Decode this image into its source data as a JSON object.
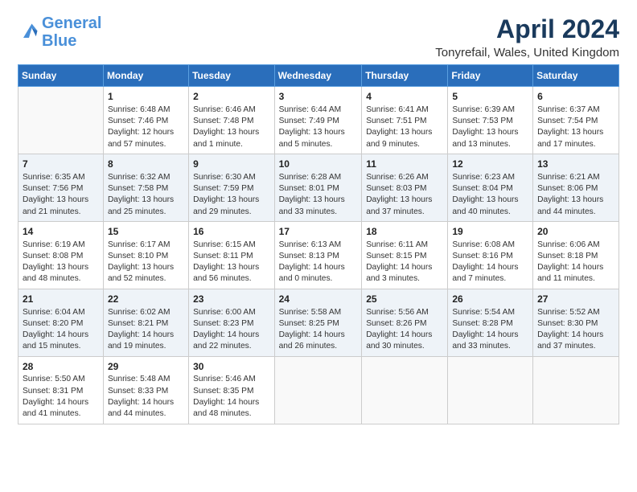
{
  "logo": {
    "text_general": "General",
    "text_blue": "Blue"
  },
  "title": "April 2024",
  "subtitle": "Tonyrefail, Wales, United Kingdom",
  "calendar": {
    "headers": [
      "Sunday",
      "Monday",
      "Tuesday",
      "Wednesday",
      "Thursday",
      "Friday",
      "Saturday"
    ],
    "weeks": [
      [
        {
          "day": "",
          "info": ""
        },
        {
          "day": "1",
          "info": "Sunrise: 6:48 AM\nSunset: 7:46 PM\nDaylight: 12 hours\nand 57 minutes."
        },
        {
          "day": "2",
          "info": "Sunrise: 6:46 AM\nSunset: 7:48 PM\nDaylight: 13 hours\nand 1 minute."
        },
        {
          "day": "3",
          "info": "Sunrise: 6:44 AM\nSunset: 7:49 PM\nDaylight: 13 hours\nand 5 minutes."
        },
        {
          "day": "4",
          "info": "Sunrise: 6:41 AM\nSunset: 7:51 PM\nDaylight: 13 hours\nand 9 minutes."
        },
        {
          "day": "5",
          "info": "Sunrise: 6:39 AM\nSunset: 7:53 PM\nDaylight: 13 hours\nand 13 minutes."
        },
        {
          "day": "6",
          "info": "Sunrise: 6:37 AM\nSunset: 7:54 PM\nDaylight: 13 hours\nand 17 minutes."
        }
      ],
      [
        {
          "day": "7",
          "info": "Sunrise: 6:35 AM\nSunset: 7:56 PM\nDaylight: 13 hours\nand 21 minutes."
        },
        {
          "day": "8",
          "info": "Sunrise: 6:32 AM\nSunset: 7:58 PM\nDaylight: 13 hours\nand 25 minutes."
        },
        {
          "day": "9",
          "info": "Sunrise: 6:30 AM\nSunset: 7:59 PM\nDaylight: 13 hours\nand 29 minutes."
        },
        {
          "day": "10",
          "info": "Sunrise: 6:28 AM\nSunset: 8:01 PM\nDaylight: 13 hours\nand 33 minutes."
        },
        {
          "day": "11",
          "info": "Sunrise: 6:26 AM\nSunset: 8:03 PM\nDaylight: 13 hours\nand 37 minutes."
        },
        {
          "day": "12",
          "info": "Sunrise: 6:23 AM\nSunset: 8:04 PM\nDaylight: 13 hours\nand 40 minutes."
        },
        {
          "day": "13",
          "info": "Sunrise: 6:21 AM\nSunset: 8:06 PM\nDaylight: 13 hours\nand 44 minutes."
        }
      ],
      [
        {
          "day": "14",
          "info": "Sunrise: 6:19 AM\nSunset: 8:08 PM\nDaylight: 13 hours\nand 48 minutes."
        },
        {
          "day": "15",
          "info": "Sunrise: 6:17 AM\nSunset: 8:10 PM\nDaylight: 13 hours\nand 52 minutes."
        },
        {
          "day": "16",
          "info": "Sunrise: 6:15 AM\nSunset: 8:11 PM\nDaylight: 13 hours\nand 56 minutes."
        },
        {
          "day": "17",
          "info": "Sunrise: 6:13 AM\nSunset: 8:13 PM\nDaylight: 14 hours\nand 0 minutes."
        },
        {
          "day": "18",
          "info": "Sunrise: 6:11 AM\nSunset: 8:15 PM\nDaylight: 14 hours\nand 3 minutes."
        },
        {
          "day": "19",
          "info": "Sunrise: 6:08 AM\nSunset: 8:16 PM\nDaylight: 14 hours\nand 7 minutes."
        },
        {
          "day": "20",
          "info": "Sunrise: 6:06 AM\nSunset: 8:18 PM\nDaylight: 14 hours\nand 11 minutes."
        }
      ],
      [
        {
          "day": "21",
          "info": "Sunrise: 6:04 AM\nSunset: 8:20 PM\nDaylight: 14 hours\nand 15 minutes."
        },
        {
          "day": "22",
          "info": "Sunrise: 6:02 AM\nSunset: 8:21 PM\nDaylight: 14 hours\nand 19 minutes."
        },
        {
          "day": "23",
          "info": "Sunrise: 6:00 AM\nSunset: 8:23 PM\nDaylight: 14 hours\nand 22 minutes."
        },
        {
          "day": "24",
          "info": "Sunrise: 5:58 AM\nSunset: 8:25 PM\nDaylight: 14 hours\nand 26 minutes."
        },
        {
          "day": "25",
          "info": "Sunrise: 5:56 AM\nSunset: 8:26 PM\nDaylight: 14 hours\nand 30 minutes."
        },
        {
          "day": "26",
          "info": "Sunrise: 5:54 AM\nSunset: 8:28 PM\nDaylight: 14 hours\nand 33 minutes."
        },
        {
          "day": "27",
          "info": "Sunrise: 5:52 AM\nSunset: 8:30 PM\nDaylight: 14 hours\nand 37 minutes."
        }
      ],
      [
        {
          "day": "28",
          "info": "Sunrise: 5:50 AM\nSunset: 8:31 PM\nDaylight: 14 hours\nand 41 minutes."
        },
        {
          "day": "29",
          "info": "Sunrise: 5:48 AM\nSunset: 8:33 PM\nDaylight: 14 hours\nand 44 minutes."
        },
        {
          "day": "30",
          "info": "Sunrise: 5:46 AM\nSunset: 8:35 PM\nDaylight: 14 hours\nand 48 minutes."
        },
        {
          "day": "",
          "info": ""
        },
        {
          "day": "",
          "info": ""
        },
        {
          "day": "",
          "info": ""
        },
        {
          "day": "",
          "info": ""
        }
      ]
    ]
  }
}
